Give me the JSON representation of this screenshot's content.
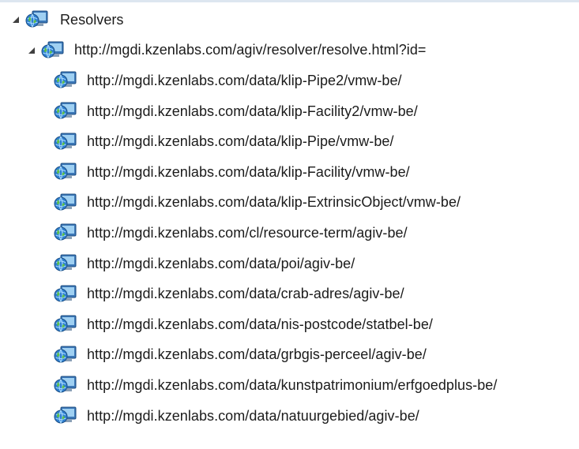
{
  "tree": {
    "root": {
      "label": "Resolvers",
      "icon": "network-globe-icon",
      "expanded": true
    },
    "resolver": {
      "label": "http://mgdi.kzenlabs.com/agiv/resolver/resolve.html?id=",
      "icon": "network-globe-icon",
      "expanded": true
    },
    "children": [
      {
        "label": "http://mgdi.kzenlabs.com/data/klip-Pipe2/vmw-be/"
      },
      {
        "label": "http://mgdi.kzenlabs.com/data/klip-Facility2/vmw-be/"
      },
      {
        "label": "http://mgdi.kzenlabs.com/data/klip-Pipe/vmw-be/"
      },
      {
        "label": "http://mgdi.kzenlabs.com/data/klip-Facility/vmw-be/"
      },
      {
        "label": "http://mgdi.kzenlabs.com/data/klip-ExtrinsicObject/vmw-be/"
      },
      {
        "label": "http://mgdi.kzenlabs.com/cl/resource-term/agiv-be/"
      },
      {
        "label": "http://mgdi.kzenlabs.com/data/poi/agiv-be/"
      },
      {
        "label": "http://mgdi.kzenlabs.com/data/crab-adres/agiv-be/"
      },
      {
        "label": "http://mgdi.kzenlabs.com/data/nis-postcode/statbel-be/"
      },
      {
        "label": "http://mgdi.kzenlabs.com/data/grbgis-perceel/agiv-be/"
      },
      {
        "label": "http://mgdi.kzenlabs.com/data/kunstpatrimonium/erfgoedplus-be/"
      },
      {
        "label": "http://mgdi.kzenlabs.com/data/natuurgebied/agiv-be/"
      }
    ]
  }
}
